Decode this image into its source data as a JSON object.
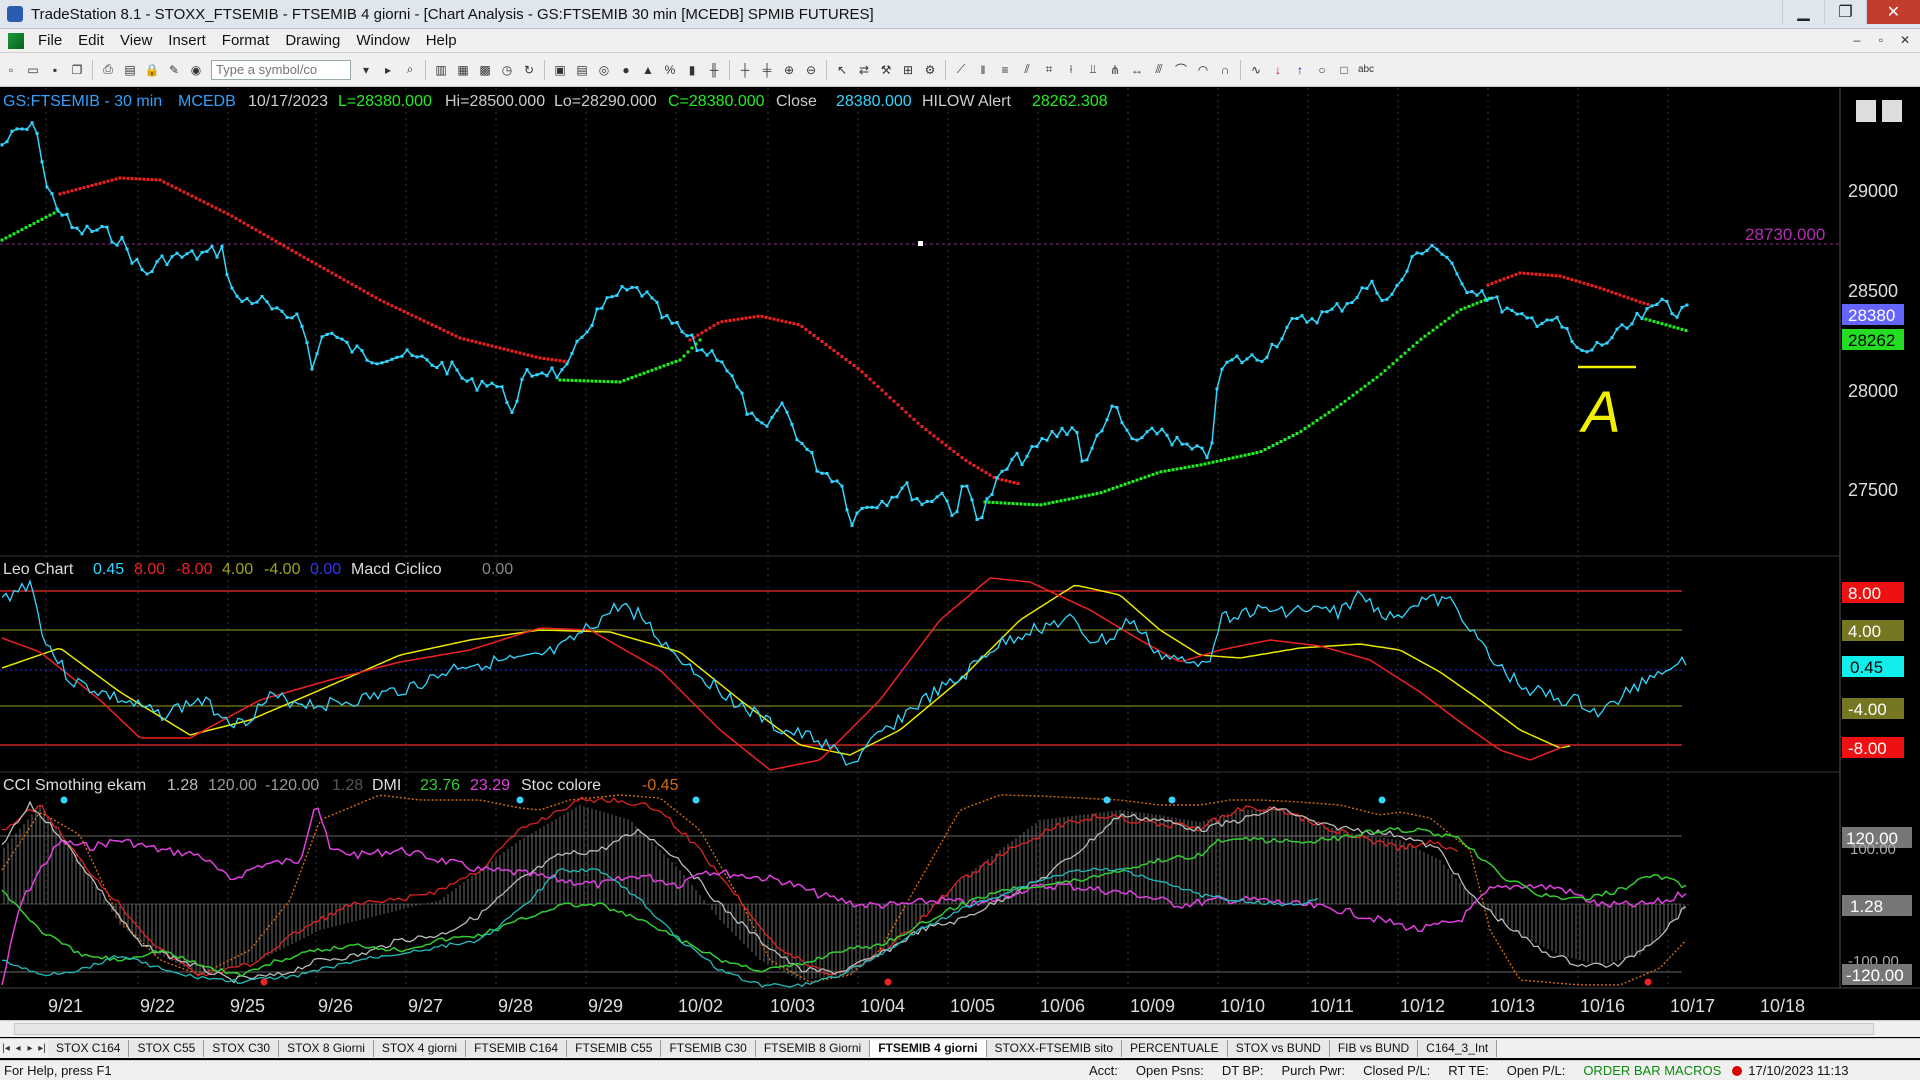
{
  "window": {
    "title": "TradeStation 8.1 - STOXX_FTSEMIB - FTSEMIB  4 giorni - [Chart Analysis - GS:FTSEMIB  30 min  [MCEDB] SPMIB FUTURES]"
  },
  "menu": [
    "File",
    "Edit",
    "View",
    "Insert",
    "Format",
    "Drawing",
    "Window",
    "Help"
  ],
  "toolbar": {
    "symbol_placeholder": "Type a symbol/co"
  },
  "price_panel": {
    "header": {
      "symbol": "GS:FTSEMIB - 30 min",
      "source": "MCEDB",
      "date": "10/17/2023",
      "last": "L=28380.000",
      "hi": "Hi=28500.000",
      "lo": "Lo=28290.000",
      "close_eq": "C=28380.000",
      "close_label": "Close",
      "close_value": "28380.000",
      "alert_label": "HILOW Alert",
      "alert_value": "28262.308"
    },
    "axis_labels": [
      "29000",
      "28500",
      "28000",
      "27500"
    ],
    "level_line_label": "28730.000",
    "price_tag": "28380",
    "alert_tag": "28262",
    "annotation": "A"
  },
  "leo_panel": {
    "header": {
      "name": "Leo Chart",
      "v1": "0.45",
      "v2": "8.00",
      "v3": "-8.00",
      "v4": "4.00",
      "v5": "-4.00",
      "v6": "0.00",
      "macd_name": "Macd Ciclico",
      "macd_value": "0.00"
    },
    "tags": [
      "8.00",
      "4.00",
      "0.45",
      "-4.00",
      "-8.00"
    ]
  },
  "cci_panel": {
    "header": {
      "name": "CCI Smothing ekam",
      "v1": "1.28",
      "v2": "120.00",
      "v3": "-120.00",
      "v4": "1.28",
      "dmi_label": "DMI",
      "dmi1": "23.76",
      "dmi2": "23.29",
      "stoc_label": "Stoc colore",
      "stoc_value": "-0.45"
    },
    "tags": [
      "120.00",
      "100.00",
      "1.28",
      "-100.00",
      "-120.00"
    ]
  },
  "date_axis": [
    "9/21",
    "9/22",
    "9/25",
    "9/26",
    "9/27",
    "9/28",
    "9/29",
    "10/02",
    "10/03",
    "10/04",
    "10/05",
    "10/06",
    "10/09",
    "10/10",
    "10/11",
    "10/12",
    "10/13",
    "10/16",
    "10/17",
    "10/18"
  ],
  "tabs": [
    "STOX C164",
    "STOX C55",
    "STOX  C30",
    "STOX  8 Giorni",
    "STOX 4 giorni",
    "FTSEMIB C164",
    "FTSEMIB C55",
    "FTSEMIB C30",
    "FTSEMIB  8 Giorni",
    "FTSEMIB  4 giorni",
    "STOXX-FTSEMIB sito",
    "PERCENTUALE",
    "STOX vs BUND",
    "FIB vs BUND",
    "C164_3_Int"
  ],
  "active_tab_index": 9,
  "status": {
    "help": "For Help, press F1",
    "acct": "Acct:",
    "open_psns": "Open Psns:",
    "dt_bp": "DT BP:",
    "purch_pwr": "Purch Pwr:",
    "closed_pl": "Closed P/L:",
    "rt_te": "RT TE:",
    "open_pl": "Open P/L:",
    "macros": "ORDER BAR  MACROS",
    "datetime": "17/10/2023 11:13"
  },
  "colors": {
    "price": "#33d6ff",
    "ma_up": "#22ee22",
    "ma_down": "#ee2222",
    "yellow": "#e8e800",
    "magenta": "#e040e0",
    "background": "#000000"
  }
}
